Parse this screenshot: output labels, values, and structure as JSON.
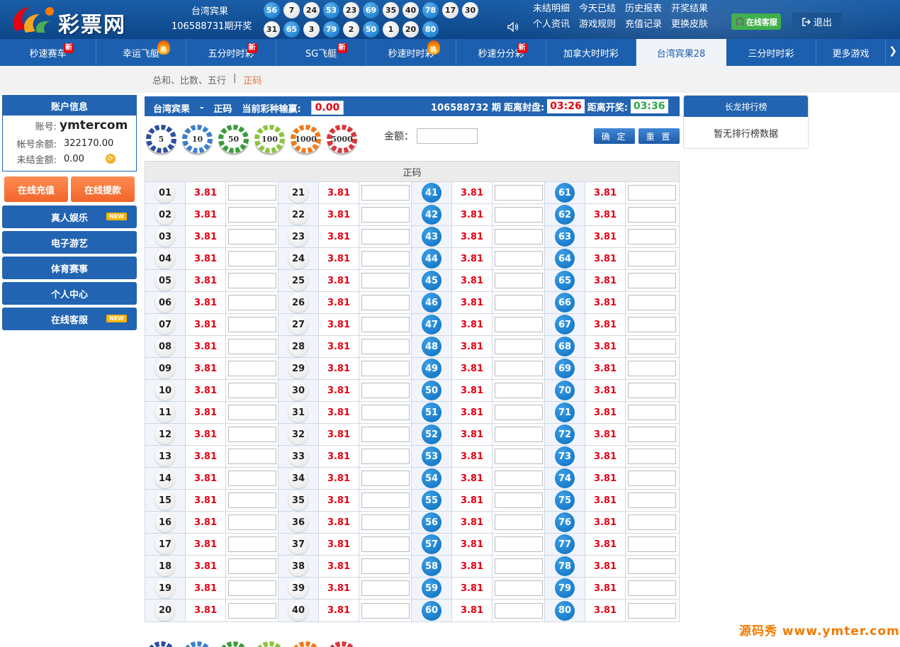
{
  "header": {
    "logo_text": "彩票网",
    "game_name": "台湾宾果",
    "draw_text": "106588731期开奖",
    "balls_row1": [
      "56",
      "7",
      "24",
      "53",
      "23",
      "69",
      "35",
      "40",
      "78",
      "17",
      "30"
    ],
    "balls_row2": [
      "31",
      "65",
      "3",
      "79",
      "2",
      "50",
      "1",
      "20",
      "80"
    ],
    "links_row1": [
      "未结明细",
      "今天已结",
      "历史报表",
      "开奖结果"
    ],
    "links_row2": [
      "个人资讯",
      "游戏规则",
      "充值记录",
      "更换皮肤"
    ],
    "cs_label": "在线客服",
    "logout_label": "退出"
  },
  "nav": [
    {
      "label": "秒速赛车",
      "badge": "新",
      "badge_type": "new"
    },
    {
      "label": "幸运飞艇",
      "badge": "热",
      "badge_type": "hot"
    },
    {
      "label": "五分时时彩",
      "badge": "新",
      "badge_type": "new"
    },
    {
      "label": "SG飞艇",
      "badge": "新",
      "badge_type": "new"
    },
    {
      "label": "秒速时时彩",
      "badge": "热",
      "badge_type": "hot"
    },
    {
      "label": "秒速分分彩",
      "badge": "新",
      "badge_type": "new"
    },
    {
      "label": "加拿大时时彩",
      "badge": "",
      "badge_type": ""
    },
    {
      "label": "台湾宾果28",
      "badge": "",
      "badge_type": "",
      "active": true
    },
    {
      "label": "三分时时彩",
      "badge": "",
      "badge_type": ""
    },
    {
      "label": "更多游戏",
      "badge": "",
      "badge_type": ""
    }
  ],
  "breadcrumb": {
    "item1": "总和、比数、五行",
    "sep": "|",
    "item2": "正码"
  },
  "account": {
    "title": "账户信息",
    "user_key": "账号:",
    "user_val": "ymtercom",
    "balance_key": "帐号余额:",
    "balance_val": "322170.00",
    "unsettled_key": "未结金额:",
    "unsettled_val": "0.00"
  },
  "sidebar": {
    "recharge": "在线充值",
    "withdraw": "在线提款",
    "menu": [
      {
        "label": "真人娱乐",
        "tag": "NEW"
      },
      {
        "label": "电子游艺",
        "tag": ""
      },
      {
        "label": "体育赛事",
        "tag": ""
      },
      {
        "label": "个人中心",
        "tag": ""
      },
      {
        "label": "在线客服",
        "tag": "NEW"
      }
    ]
  },
  "main": {
    "game": "台湾宾果",
    "dash": "-",
    "play": "正码",
    "pnl_label": "当前彩种输赢:",
    "pnl_val": "0.00",
    "period": "106588732 期",
    "close_label": "距离封盘:",
    "close_val": "03:26",
    "draw_label": "距离开奖:",
    "draw_val": "03:36",
    "chips": [
      "5",
      "10",
      "50",
      "100",
      "1000",
      "5000"
    ],
    "amount_label": "金额：",
    "confirm": "确 定",
    "reset": "重 置",
    "table_title": "正码",
    "odds": "3.81"
  },
  "rank": {
    "title": "长龙排行榜",
    "empty": "暂无排行榜数据"
  },
  "watermark": "源码秀 www.ymter.com"
}
